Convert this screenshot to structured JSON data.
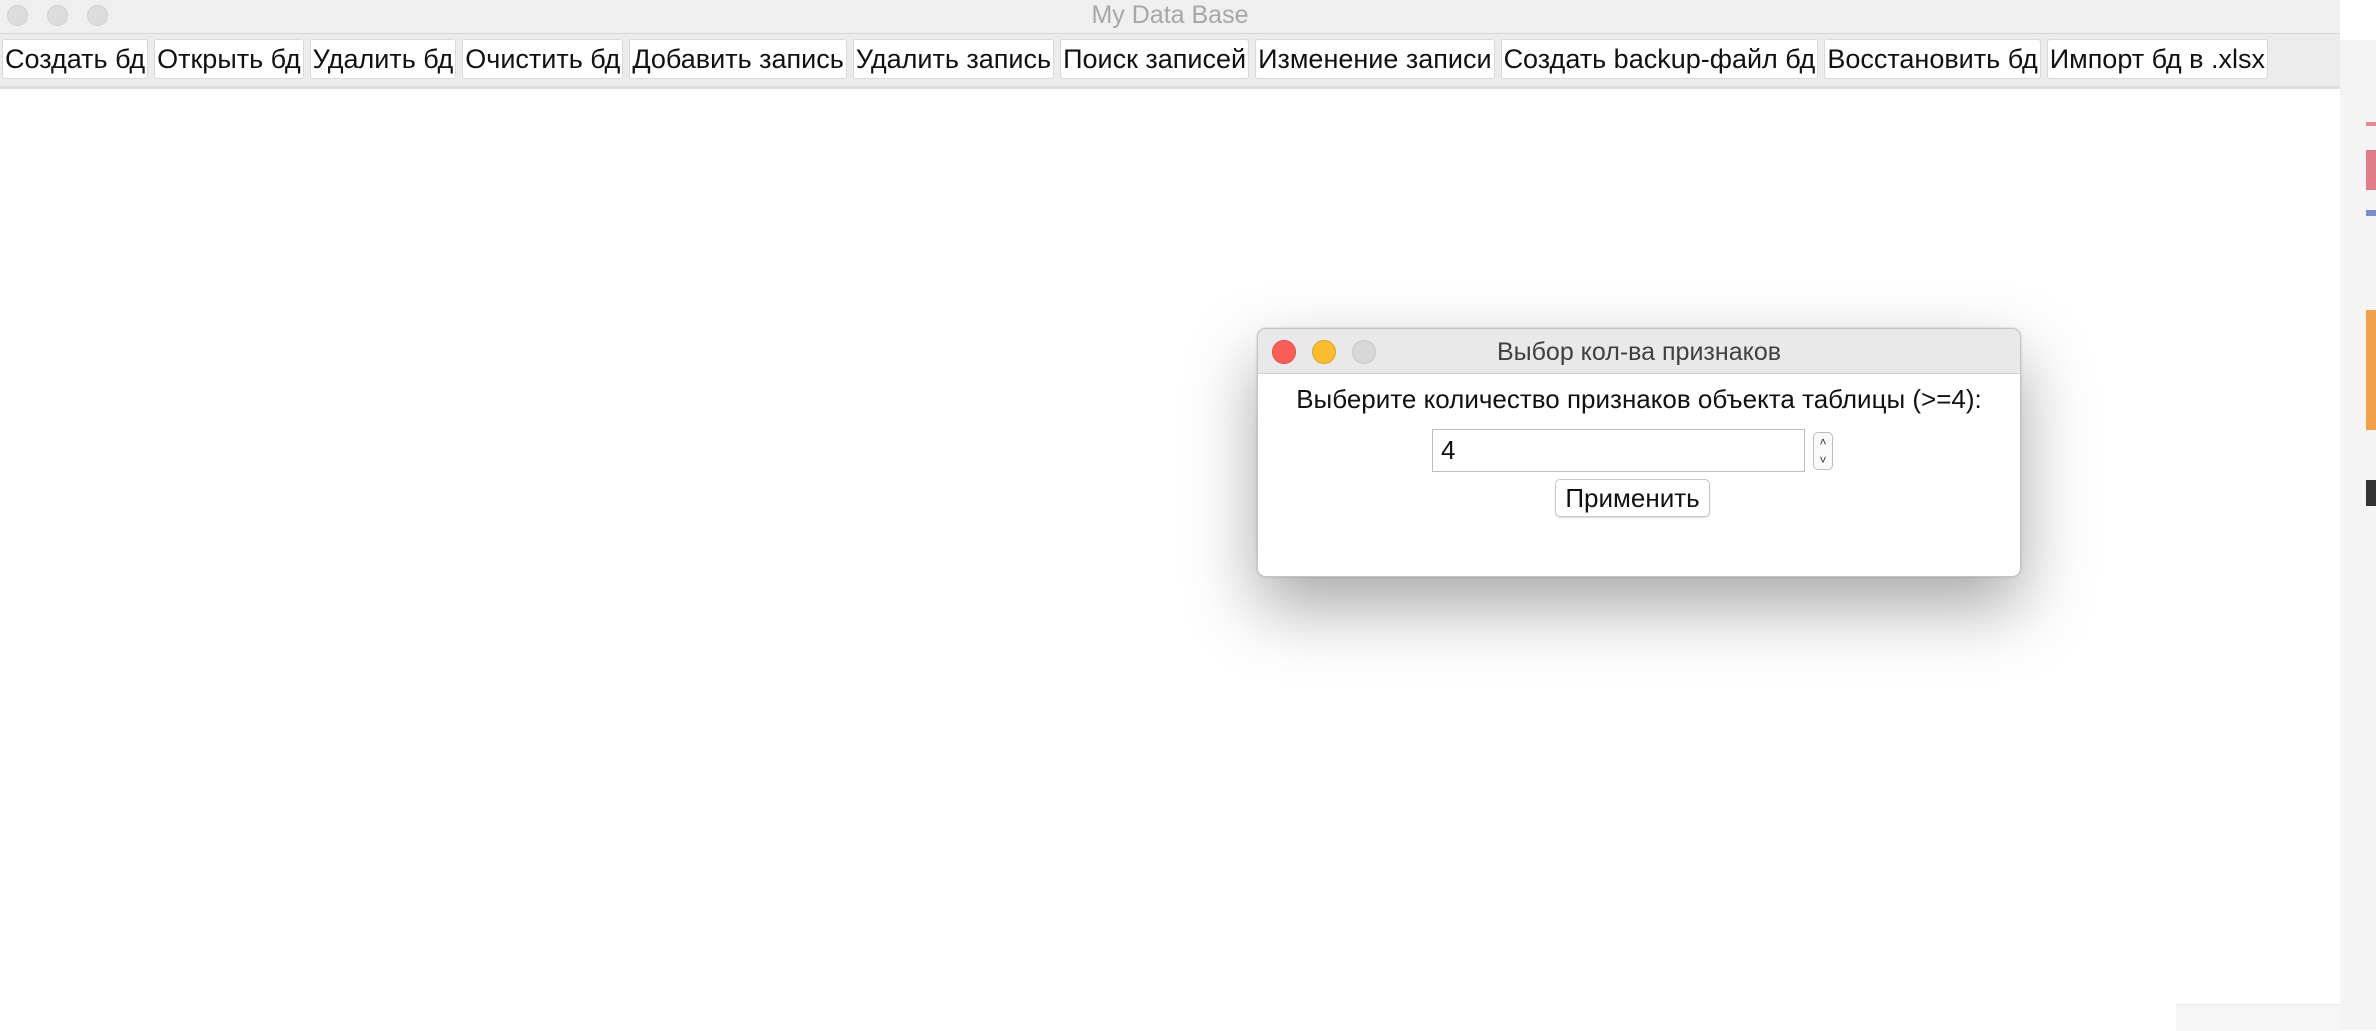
{
  "window": {
    "title": "My Data Base"
  },
  "toolbar": {
    "buttons": [
      "Создать бд",
      "Открыть бд",
      "Удалить бд",
      "Очистить бд",
      "Добавить запись",
      "Удалить запись",
      "Поиск записей",
      "Изменение записи",
      "Создать backup-файл бд",
      "Восстановить бд",
      "Импорт бд в .xlsx"
    ]
  },
  "dialog": {
    "title": "Выбор кол-ва признаков",
    "prompt": "Выберите количество признаков объекта таблицы (>=4):",
    "input_value": "4",
    "stepper_up_icon": "chevron-up-icon",
    "stepper_down_icon": "chevron-down-icon",
    "apply_label": "Применить",
    "colors": {
      "close": "#fc5f57",
      "minimize": "#fdbc2e",
      "zoom": "#d7d7d7"
    }
  }
}
